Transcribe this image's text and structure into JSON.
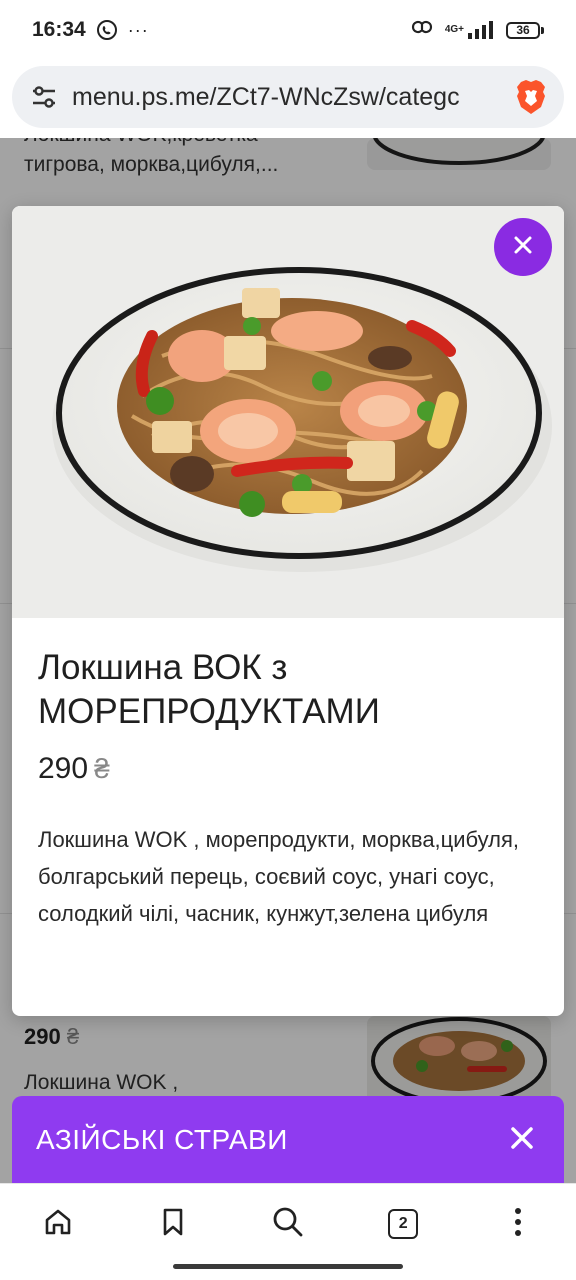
{
  "status_bar": {
    "time": "16:34",
    "dots": "···",
    "network_label_top": "4G+",
    "battery": "36",
    "icons": [
      "viber-icon",
      "hotspot-icon",
      "signal-icon",
      "battery-icon"
    ]
  },
  "browser": {
    "url": "menu.ps.me/ZCt7-WNcZsw/categc",
    "icons": [
      "site-settings-icon",
      "brave-logo-icon"
    ]
  },
  "background_page": {
    "item_top": {
      "desc_line1": "Локшина WOK,креветка",
      "desc_line2": "тигрова, морква,цибуля,..."
    },
    "item_bottom": {
      "price": "290",
      "currency": "₴",
      "desc": "Локшина WOK ,"
    }
  },
  "modal": {
    "title": "Локшина ВОК з МОРЕПРОДУКТАМИ",
    "price": "290",
    "currency": "₴",
    "description": "Локшина WOK , морепродукти, морква,цибуля, болгарський перець, соєвий соус, унагі соус, солодкий чілі, часник, кунжут,зелена цибуля",
    "image_alt": "noodle-wok-seafood-photo",
    "close_icon": "close-icon"
  },
  "category_bar": {
    "label": "АЗІЙСЬКІ СТРАВИ",
    "close_icon": "close-icon"
  },
  "bottom_nav": {
    "tabs_count": "2",
    "items": [
      "home-icon",
      "bookmark-icon",
      "search-icon",
      "tabs-icon",
      "more-menu-icon"
    ]
  },
  "colors": {
    "accent_purple": "#8f3bf0",
    "close_button_purple": "#8a2be2"
  }
}
